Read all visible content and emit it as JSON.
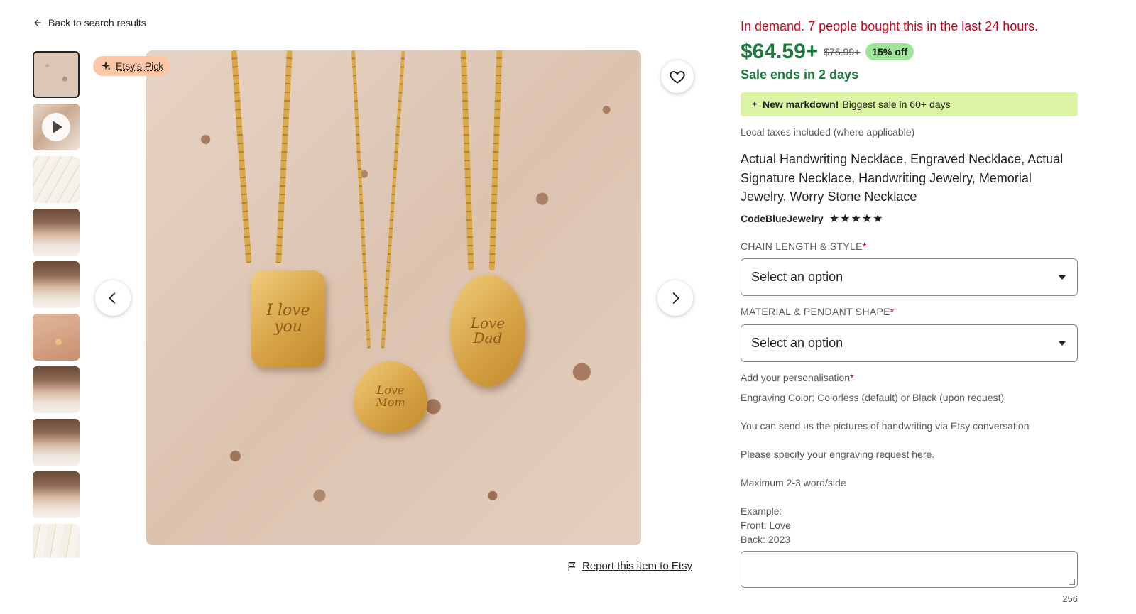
{
  "nav": {
    "back_label": "Back to search results"
  },
  "gallery": {
    "badge_label": "Etsy's Pick",
    "thumbnails": [
      "thumb-1",
      "thumb-2-video",
      "thumb-3",
      "thumb-4",
      "thumb-5",
      "thumb-6",
      "thumb-7",
      "thumb-8",
      "thumb-9",
      "thumb-10"
    ],
    "engravings": {
      "pendant_left": "I love you",
      "pendant_middle": "Love Mom",
      "pendant_right": "Love Dad"
    },
    "report_label": "Report this item to Etsy"
  },
  "product": {
    "demand_text": "In demand. 7 people bought this in the last 24 hours.",
    "price": "$64.59+",
    "original_price": "$75.99+",
    "discount": "15% off",
    "sale_ends": "Sale ends in 2 days",
    "markdown_bold": "New markdown!",
    "markdown_text": "Biggest sale in 60+ days",
    "taxes": "Local taxes included (where applicable)",
    "title": "Actual Handwriting Necklace, Engraved Necklace, Actual Signature Necklace, Handwriting Jewelry, Memorial Jewelry, Worry Stone Necklace",
    "shop_name": "CodeBlueJewelry",
    "rating_stars": "★★★★★",
    "rating": 5
  },
  "options": {
    "chain_label": "CHAIN LENGTH & STYLE",
    "chain_value": "Select an option",
    "material_label": "MATERIAL & PENDANT SHAPE",
    "material_value": "Select an option",
    "required_mark": "*"
  },
  "personalisation": {
    "label": "Add your personalisation",
    "line1": "Engraving Color: Colorless (default) or Black (upon request)",
    "line2": "You can send us the pictures of handwriting via Etsy conversation",
    "line3": "Please specify your engraving request here.",
    "line4": "Maximum 2-3 word/side",
    "example_1": "Example:",
    "example_2": "Front: Love",
    "example_3": "Back: 2023",
    "textarea_value": "",
    "char_count": "256"
  },
  "colors": {
    "demand_red": "#d0021b",
    "price_green": "#1e7a3c",
    "discount_bg": "#9ee59a",
    "markdown_bg": "#dcf3a3",
    "badge_bg": "#fbc7a7"
  }
}
